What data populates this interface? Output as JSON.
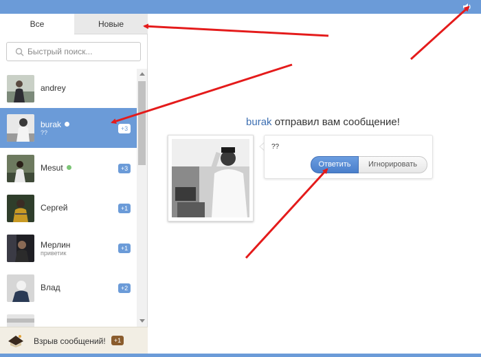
{
  "tabs": {
    "all": "Все",
    "new": "Новые"
  },
  "search": {
    "placeholder": "Быстрый поиск..."
  },
  "contacts": [
    {
      "name": "andrey",
      "sub": "",
      "online": false,
      "badge": "",
      "active": false
    },
    {
      "name": "burak",
      "sub": "??",
      "online": true,
      "badge": "+3",
      "active": true
    },
    {
      "name": "Mesut",
      "sub": "",
      "online": true,
      "badge": "+3",
      "active": false
    },
    {
      "name": "Сергей",
      "sub": "",
      "online": false,
      "badge": "+1",
      "active": false
    },
    {
      "name": "Мерлин",
      "sub": "приветик",
      "online": false,
      "badge": "+1",
      "active": false
    },
    {
      "name": "Влад",
      "sub": "",
      "online": false,
      "badge": "+2",
      "active": false
    }
  ],
  "footer": {
    "label": "Взрыв сообщений!",
    "badge": "+1"
  },
  "notification": {
    "author": "burak",
    "text": "отправил вам сообщение!",
    "message": "??",
    "reply_label": "Ответить",
    "ignore_label": "Игнорировать"
  },
  "colors": {
    "accent": "#6b9bd8",
    "online": "#7cc576",
    "annotation": "#e41b1b"
  }
}
